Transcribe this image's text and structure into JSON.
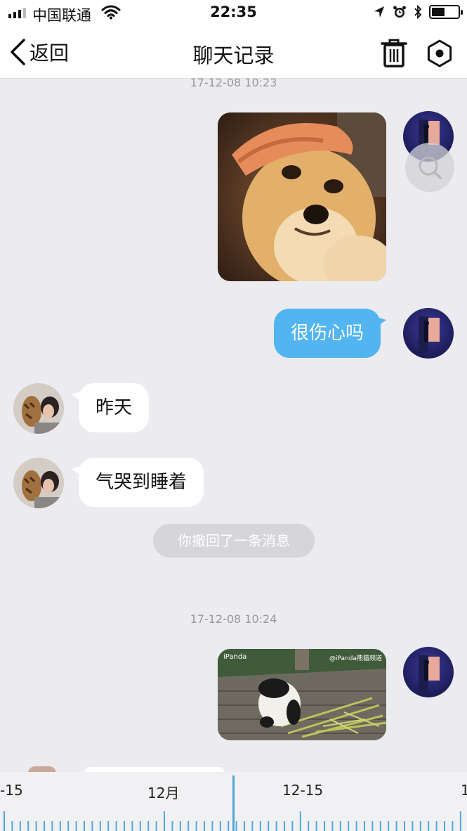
{
  "status_bar": {
    "carrier": "中国联通",
    "time": "22:35",
    "battery_level": 0.45
  },
  "nav": {
    "back_label": "返回",
    "title": "聊天记录",
    "trash_icon": "trash-icon",
    "settings_icon": "settings-hexagon-icon"
  },
  "messages": {
    "ts_top": "17-12-08 10:23",
    "text_1": "很伤心吗",
    "text_2": "昨天",
    "text_3": "气哭到睡着",
    "recalled": "你撤回了一条消息",
    "ts_2": "17-12-08 10:24",
    "image_1_desc": "shiba-dog-image",
    "image_2_caption_left": "iPanda",
    "image_2_caption_right": "@iPanda熊猫频道"
  },
  "timeline": {
    "label_left": "-15",
    "label_mid": "12月",
    "label_right": "12-15",
    "label_edge": "1"
  },
  "colors": {
    "accent": "#52b4f0",
    "background": "#ebebf0",
    "timeline_cursor": "#52a7d9"
  }
}
